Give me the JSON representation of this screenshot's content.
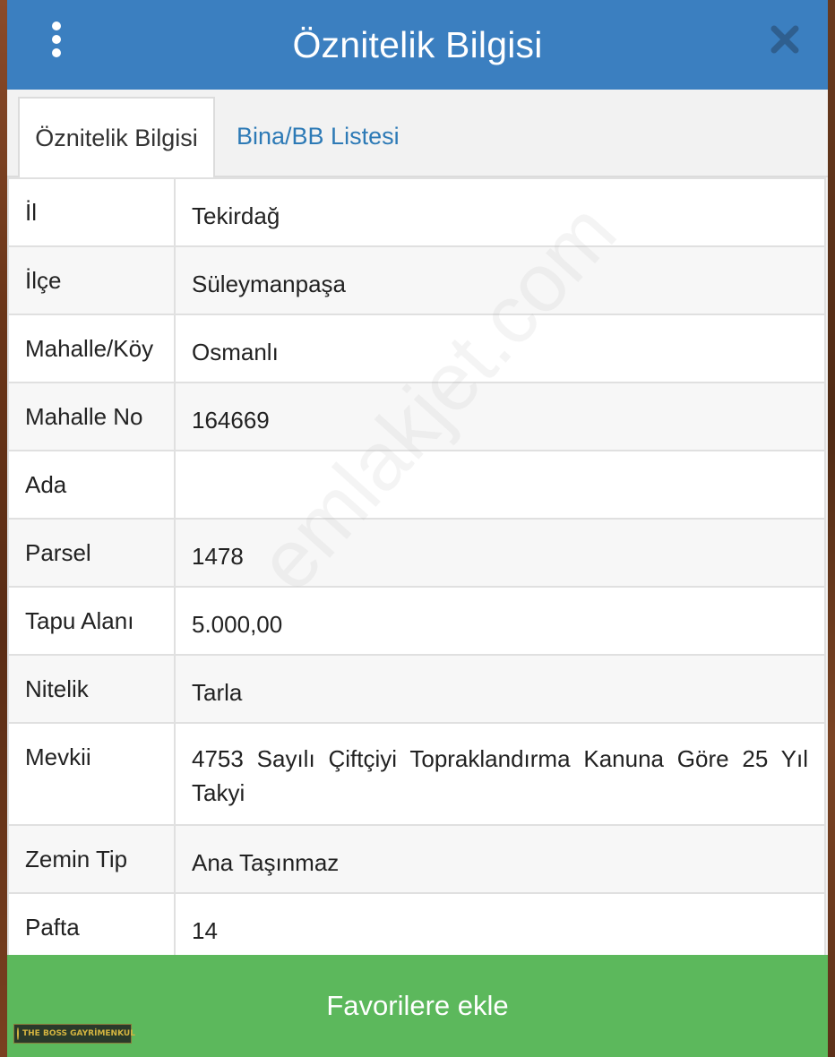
{
  "header": {
    "title": "Öznitelik Bilgisi"
  },
  "tabs": [
    {
      "label": "Öznitelik Bilgisi",
      "active": true
    },
    {
      "label": "Bina/BB Listesi",
      "active": false
    }
  ],
  "rows": [
    {
      "key": "İl",
      "value": "Tekirdağ"
    },
    {
      "key": "İlçe",
      "value": "Süleymanpaşa"
    },
    {
      "key": "Mahalle/Köy",
      "value": "Osmanlı"
    },
    {
      "key": "Mahalle No",
      "value": "164669"
    },
    {
      "key": "Ada",
      "value": ""
    },
    {
      "key": "Parsel",
      "value": "1478"
    },
    {
      "key": "Tapu Alanı",
      "value": "5.000,00"
    },
    {
      "key": "Nitelik",
      "value": "Tarla"
    },
    {
      "key": "Mevkii",
      "value": "4753 Sayılı Çiftçiyi Topraklandırma Kanuna Göre 25 Yıl Takyi"
    },
    {
      "key": "Zemin Tip",
      "value": "Ana Taşınmaz"
    },
    {
      "key": "Pafta",
      "value": "14"
    }
  ],
  "footer": {
    "button_label": "Favorilere ekle"
  },
  "watermark": {
    "text": "emlakjet.com"
  },
  "logo": {
    "text": "THE BOSS GAYRİMENKUL"
  },
  "colors": {
    "header": "#3b7fc0",
    "tab_link": "#2d7ab6",
    "footer": "#5cb85c"
  }
}
